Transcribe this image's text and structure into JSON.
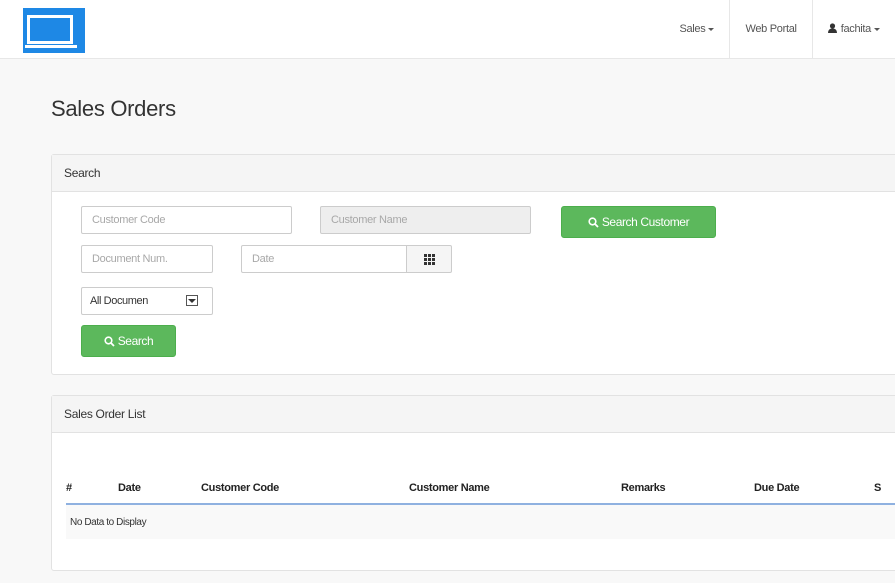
{
  "nav": {
    "items": [
      {
        "label": "Sales"
      },
      {
        "label": "Web Portal"
      },
      {
        "label": "fachita"
      }
    ]
  },
  "page": {
    "title": "Sales Orders"
  },
  "search": {
    "heading": "Search",
    "customer_code_placeholder": "Customer Code",
    "customer_name_placeholder": "Customer Name",
    "search_customer_label": "Search Customer",
    "document_num_placeholder": "Document Num.",
    "date_placeholder": "Date",
    "document_filter_value": "All Documen",
    "search_label": "Search"
  },
  "list": {
    "heading": "Sales Order List",
    "columns": [
      "#",
      "Date",
      "Customer Code",
      "Customer Name",
      "Remarks",
      "Due Date",
      "S"
    ],
    "empty_text": "No Data to Display"
  },
  "colors": {
    "brand": "#1e88e5",
    "button": "#5cb85c",
    "table_header_rule": "#8fb1e0"
  },
  "icons": {
    "logo": "computer-monitor-icon",
    "user": "user-icon",
    "search": "magnifier-icon",
    "calendar": "grid-icon"
  }
}
